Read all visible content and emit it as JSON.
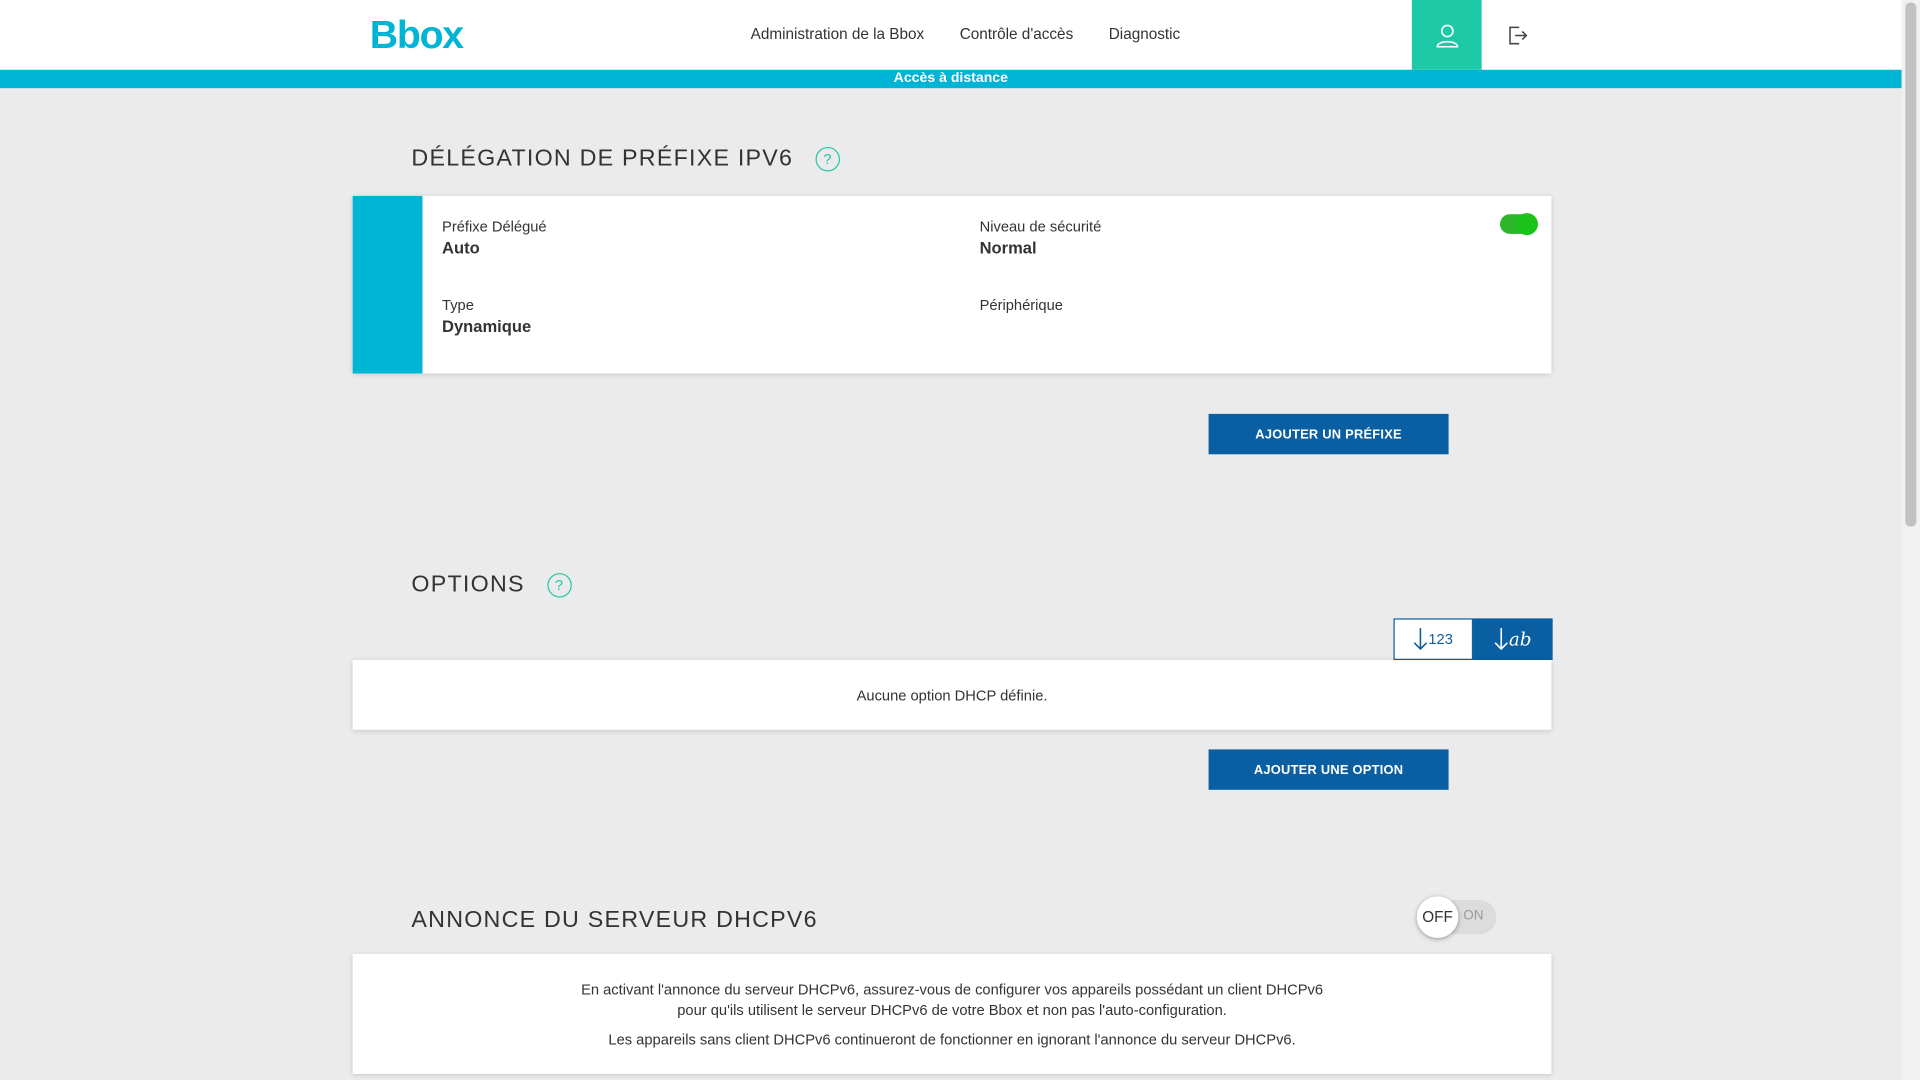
{
  "header": {
    "logo": "Bbox",
    "nav": [
      "Administration de la Bbox",
      "Contrôle d'accès",
      "Diagnostic"
    ],
    "user_icon": "user-icon",
    "logout_icon": "logout-icon"
  },
  "banner": "Accès à distance",
  "delegation": {
    "title": "DÉLÉGATION DE PRÉFIXE IPV6",
    "help": "?",
    "prefix_label": "Préfixe Délégué",
    "prefix_value": "Auto",
    "security_label": "Niveau de sécurité",
    "security_value": "Normal",
    "type_label": "Type",
    "type_value": "Dynamique",
    "device_label": "Périphérique",
    "device_value": "",
    "enabled": true,
    "add_button": "AJOUTER UN PRÉFIXE"
  },
  "options": {
    "title": "OPTIONS",
    "help": "?",
    "sort_numeric": "123",
    "sort_alpha": "ab",
    "empty_message": "Aucune option DHCP définie.",
    "add_button": "AJOUTER UNE OPTION"
  },
  "dhcp": {
    "title": "ANNONCE DU SERVEUR DHCPV6",
    "toggle_off": "OFF",
    "toggle_on": "ON",
    "line1": "En activant l'annonce du serveur DHCPv6, assurez-vous de configurer vos appareils possédant un client DHCPv6",
    "line2": "pour qu'ils utilisent le serveur DHCPv6 de votre Bbox et non pas l'auto-configuration.",
    "line3": "Les appareils sans client DHCPv6 continueront de fonctionner en ignorant l'annonce du serveur DHCPv6."
  },
  "colors": {
    "accent": "#00b4d6",
    "teal": "#1ec9a8",
    "primary_button": "#0a5fa3",
    "toggle_green": "#19c31a"
  }
}
